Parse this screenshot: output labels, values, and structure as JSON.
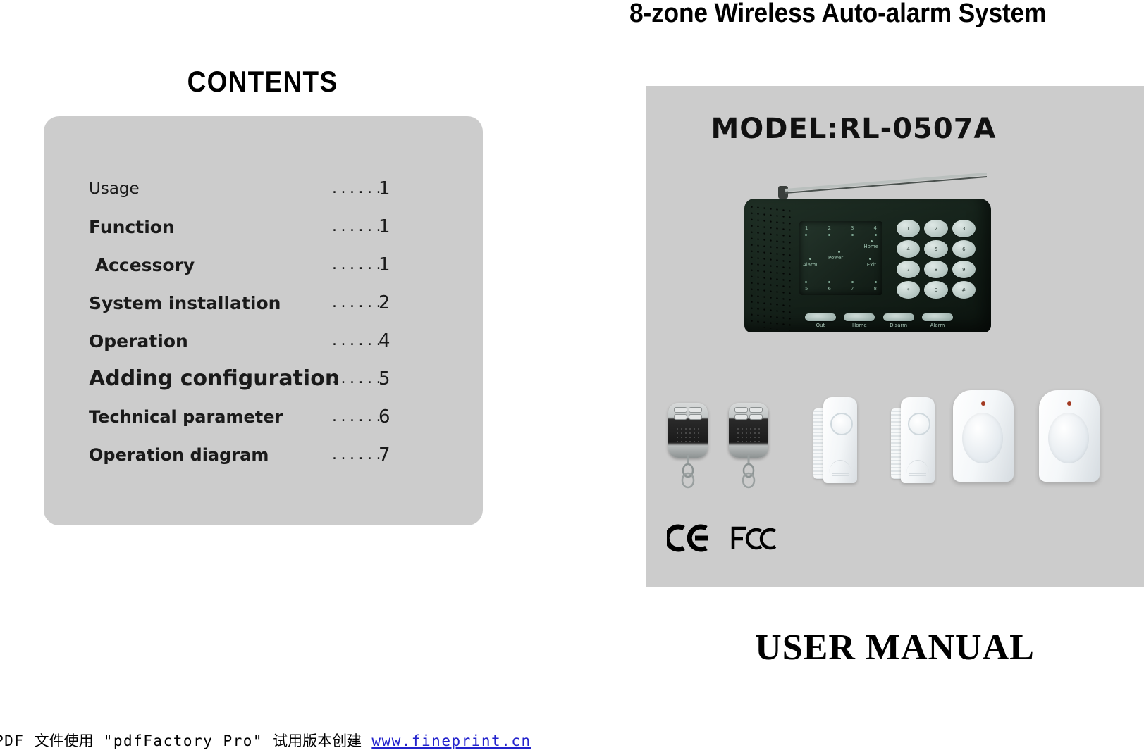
{
  "contents": {
    "heading": "CONTENTS",
    "rows": [
      {
        "label": "Usage",
        "dots": "......",
        "page": "1"
      },
      {
        "label": "Function",
        "dots": "......",
        "page": "1"
      },
      {
        "label": " Accessory",
        "dots": "......",
        "page": "1"
      },
      {
        "label": "System installation",
        "dots": "......",
        "page": "2"
      },
      {
        "label": "Operation",
        "dots": "......",
        "page": "4"
      },
      {
        "label": "Adding configuration",
        "dots": "......",
        "page": "5"
      },
      {
        "label": "Technical parameter",
        "dots": "......",
        "page": "6"
      },
      {
        "label": "Operation diagram",
        "dots": "......",
        "page": "7"
      }
    ]
  },
  "product": {
    "title": "8-zone Wireless Auto-alarm System",
    "model": "MODEL:RL-0507A",
    "manual_label": "USER MANUAL",
    "panel": {
      "zones_top": [
        "1",
        "2",
        "3",
        "4"
      ],
      "zones_bottom": [
        "5",
        "6",
        "7",
        "8"
      ],
      "indicator_labels": {
        "power": "Power",
        "home": "Home",
        "alarm": "Alarm",
        "exit": "Exit"
      },
      "keypad": [
        "1",
        "2",
        "3",
        "4",
        "5",
        "6",
        "7",
        "8",
        "9",
        "*",
        "0",
        "#"
      ],
      "function_buttons": [
        "Out",
        "Home",
        "Disarm",
        "Alarm"
      ]
    },
    "certifications": [
      "CE",
      "FCC"
    ]
  },
  "footer": {
    "prefix": "PDF ",
    "cn1": "文件使用",
    "quoted": " \"pdfFactory Pro\" ",
    "cn2": "试用版本创建",
    "url": "www.fineprint.cn"
  },
  "colors": {
    "panel_gray": "#cccccc",
    "text_black": "#000000",
    "link_blue": "#2222cc",
    "led_red": "#a23a22"
  }
}
